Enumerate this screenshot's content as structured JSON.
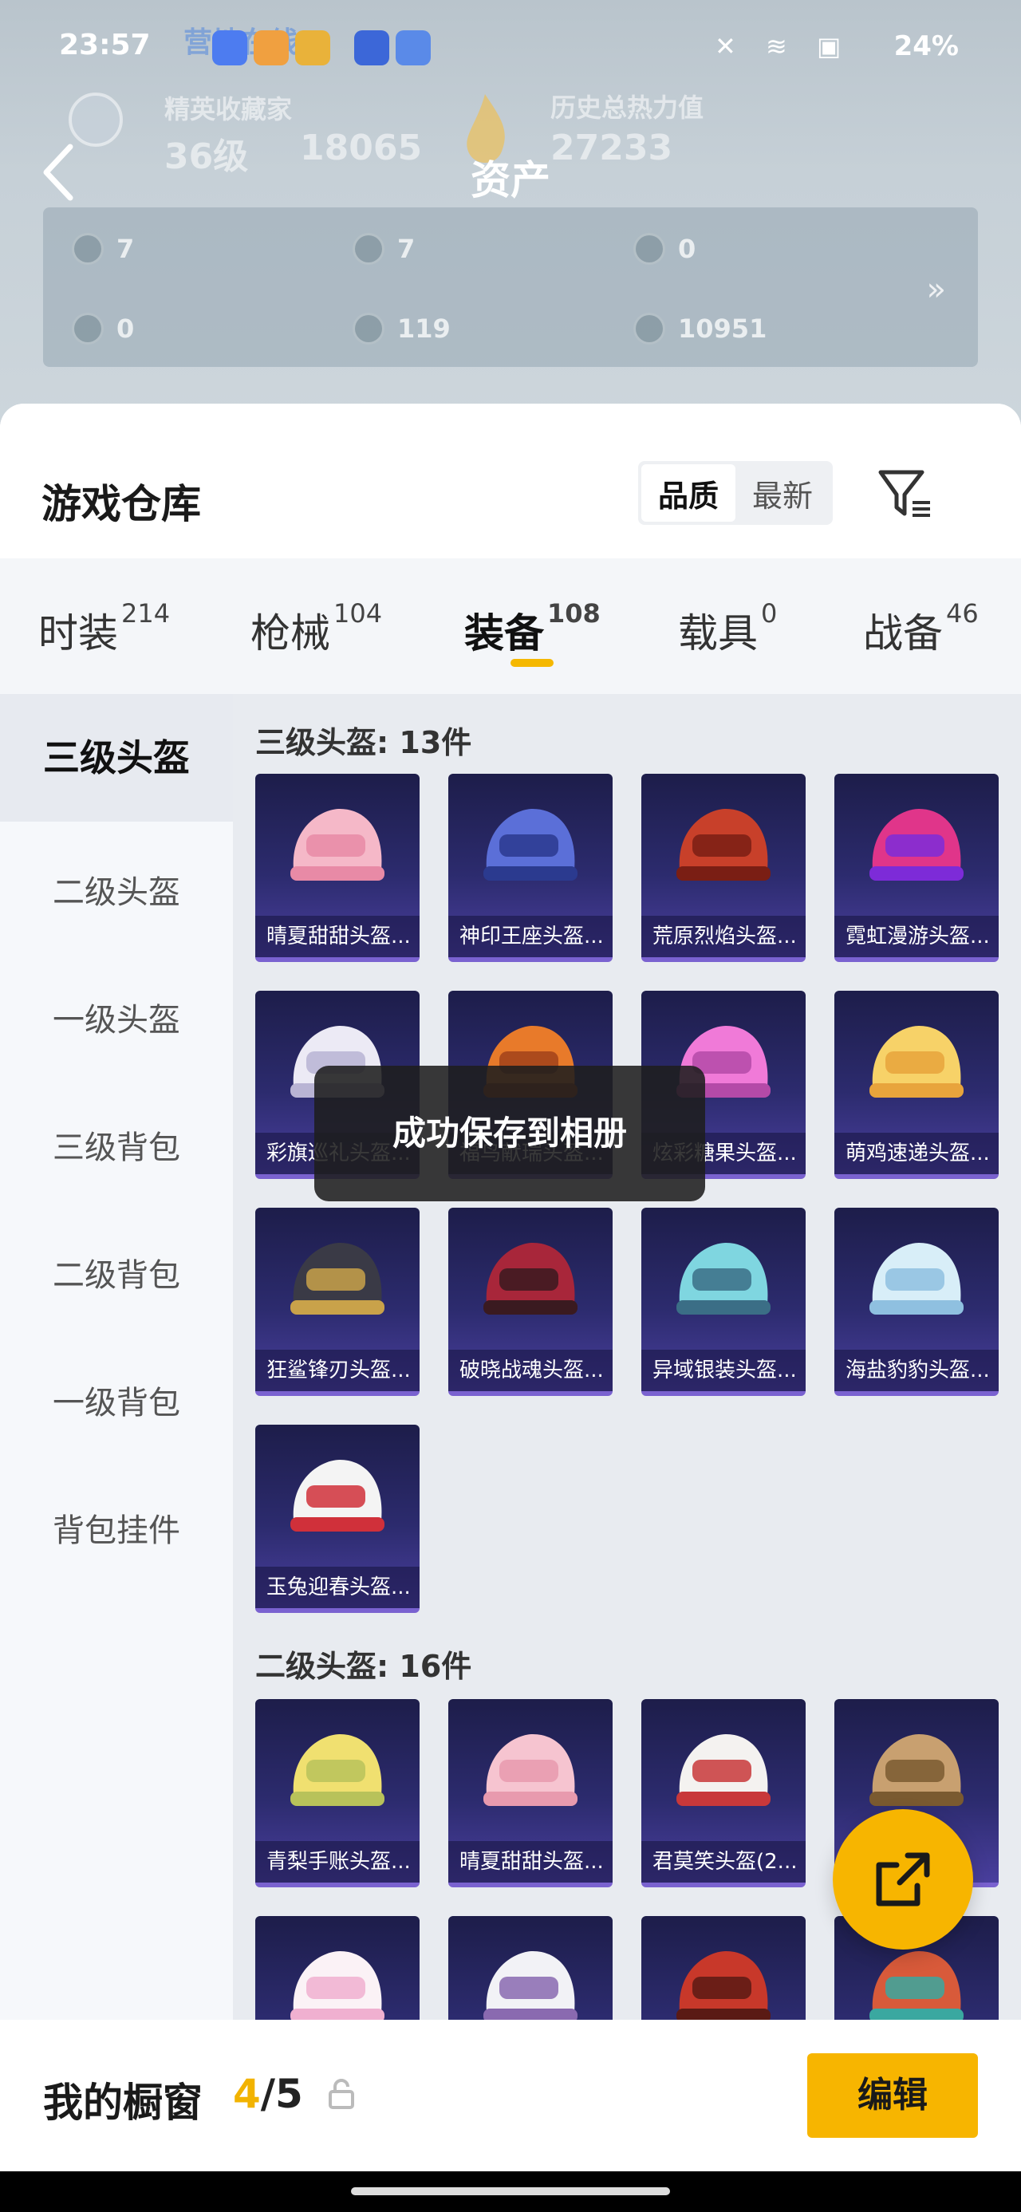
{
  "status_bar": {
    "time": "23:57",
    "battery": "24%",
    "colors": {
      "text": "#ffffff"
    }
  },
  "background_profile": {
    "ghost_line": "营地在线",
    "rank_title": "精英收藏家",
    "level": "36级",
    "score": "18065",
    "heat_label": "历史总热力值",
    "heat_value": "27233",
    "header_title": "资产",
    "assets": [
      "7",
      "7",
      "0",
      "0",
      "119",
      "10951"
    ]
  },
  "warehouse": {
    "title": "游戏仓库",
    "sort_options": [
      "品质",
      "最新"
    ],
    "sort_active": "品质",
    "tabs": [
      {
        "label": "时装",
        "count": "214"
      },
      {
        "label": "枪械",
        "count": "104"
      },
      {
        "label": "装备",
        "count": "108"
      },
      {
        "label": "载具",
        "count": "0"
      },
      {
        "label": "战备",
        "count": "46"
      }
    ],
    "active_tab": "装备",
    "accent": "#f5b800"
  },
  "sidebar": {
    "items": [
      "三级头盔",
      "二级头盔",
      "一级头盔",
      "三级背包",
      "二级背包",
      "一级背包",
      "背包挂件"
    ],
    "active": "三级头盔"
  },
  "sections": [
    {
      "header": "三级头盔: 13件",
      "items": [
        {
          "label": "晴夏甜甜头盔...",
          "art": "pink-pig-helmet"
        },
        {
          "label": "神印王座头盔...",
          "art": "blue-crown-helmet"
        },
        {
          "label": "荒原烈焰头盔...",
          "art": "red-flame-helmet"
        },
        {
          "label": "霓虹漫游头盔...",
          "art": "neon-helmet"
        },
        {
          "label": "彩旗巡礼头盔...",
          "art": "white-party-helmet"
        },
        {
          "label": "福鸟献瑞头盔...",
          "art": "orange-bird-helmet"
        },
        {
          "label": "炫彩糖果头盔...",
          "art": "pink-candy-helmet"
        },
        {
          "label": "萌鸡速递头盔...",
          "art": "yellow-chick-helmet"
        },
        {
          "label": "狂鲨锋刃头盔...",
          "art": "shark-helmet"
        },
        {
          "label": "破晓战魂头盔...",
          "art": "spiked-helmet"
        },
        {
          "label": "异域银装头盔...",
          "art": "teal-visor-helmet"
        },
        {
          "label": "海盐豹豹头盔...",
          "art": "seal-helmet"
        },
        {
          "label": "玉兔迎春头盔...",
          "art": "rabbit-helmet"
        }
      ]
    },
    {
      "header": "二级头盔: 16件",
      "items": [
        {
          "label": "青梨手账头盔...",
          "art": "pear-helmet"
        },
        {
          "label": "晴夏甜甜头盔...",
          "art": "pink-pig-helmet-2"
        },
        {
          "label": "君莫笑头盔(2...",
          "art": "white-red-helmet"
        },
        {
          "label": "",
          "art": "straw-helmet"
        },
        {
          "label": "",
          "art": "unicorn-helmet"
        },
        {
          "label": "",
          "art": "white-cow-helmet"
        },
        {
          "label": "",
          "art": "red-horn-helmet"
        },
        {
          "label": "",
          "art": "red-round-helmet"
        }
      ]
    }
  ],
  "toast": "成功保存到相册",
  "showcase": {
    "title": "我的橱窗",
    "count_current": "4",
    "count_total": "/5",
    "edit_label": "编辑"
  }
}
